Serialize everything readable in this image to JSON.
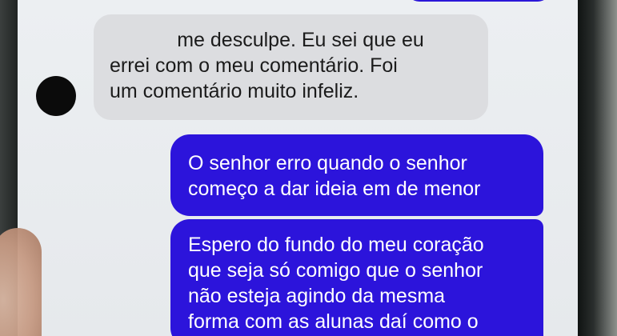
{
  "conversation": {
    "incoming": {
      "lines": [
        "me desculpe. Eu sei que eu",
        "errei com o meu comentário. Foi",
        "um comentário muito infeliz."
      ]
    },
    "outgoing": [
      {
        "lines": [
          "O senhor erro quando o senhor",
          "começo a dar ideia em de menor"
        ]
      },
      {
        "lines": [
          "Espero do fundo do meu coração",
          "que seja só comigo que o senhor",
          "não esteja agindo da mesma",
          "forma com as alunas daí como o"
        ]
      }
    ]
  },
  "colors": {
    "outgoing_bubble": "#2c14db",
    "incoming_bubble": "#dcdde0",
    "screen_background": "#e8ebee"
  }
}
